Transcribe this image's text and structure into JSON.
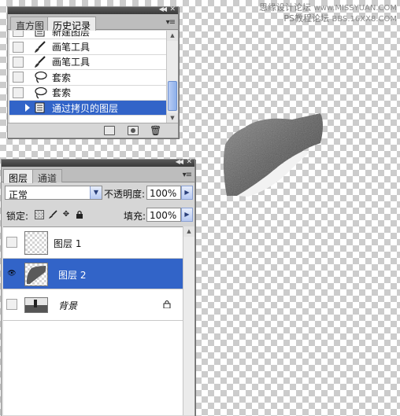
{
  "watermark": {
    "line1": "思缘设计论坛",
    "line2": "www.MISSYUAN.COM",
    "line3": "PS教程论坛",
    "line4": "BBS.16XX8.COM"
  },
  "history_panel": {
    "tabs": [
      "直方图",
      "历史记录"
    ],
    "active_tab": "历史记录",
    "items": [
      {
        "label": "新建图层",
        "icon": "new-layer-icon"
      },
      {
        "label": "画笔工具",
        "icon": "brush-icon"
      },
      {
        "label": "画笔工具",
        "icon": "brush-icon"
      },
      {
        "label": "套索",
        "icon": "lasso-icon"
      },
      {
        "label": "套索",
        "icon": "lasso-icon"
      },
      {
        "label": "通过拷贝的图层",
        "icon": "new-layer-icon",
        "selected": true
      }
    ]
  },
  "layers_panel": {
    "tabs": [
      "图层",
      "通道"
    ],
    "active_tab": "图层",
    "blend_mode": "正常",
    "opacity_label": "不透明度:",
    "opacity_value": "100%",
    "lock_label": "锁定:",
    "fill_label": "填充:",
    "fill_value": "100%",
    "layers": [
      {
        "name": "图层 1",
        "visible": false,
        "selected": false
      },
      {
        "name": "图层 2",
        "visible": true,
        "selected": true
      },
      {
        "name": "背景",
        "visible": false,
        "selected": false,
        "locked": true
      }
    ]
  },
  "colors": {
    "selection": "#3264c8",
    "panel_bg": "#d6d6d6"
  }
}
